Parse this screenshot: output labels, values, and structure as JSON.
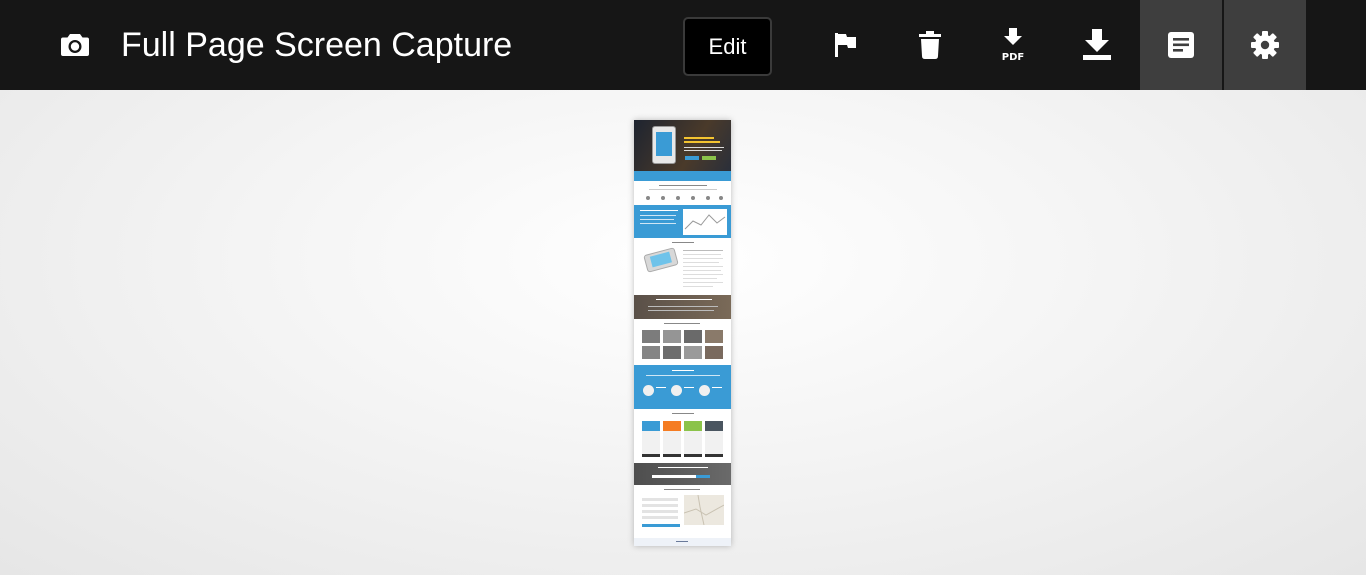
{
  "app": {
    "title": "Full Page Screen Capture",
    "icon": "camera-icon"
  },
  "toolbar": {
    "edit_label": "Edit",
    "pdf_label": "PDF",
    "tools": [
      {
        "name": "flag",
        "icon": "flag-icon"
      },
      {
        "name": "delete",
        "icon": "trash-icon"
      },
      {
        "name": "download-pdf",
        "icon": "download-pdf-icon"
      },
      {
        "name": "download-image",
        "icon": "download-icon"
      },
      {
        "name": "document",
        "icon": "document-icon"
      },
      {
        "name": "settings",
        "icon": "gear-icon"
      }
    ]
  },
  "colors": {
    "topbar": "#161616",
    "active_tool": "#3e3e3e",
    "preview_accent": "#3a9bd5",
    "background": "#f4f4f4"
  }
}
